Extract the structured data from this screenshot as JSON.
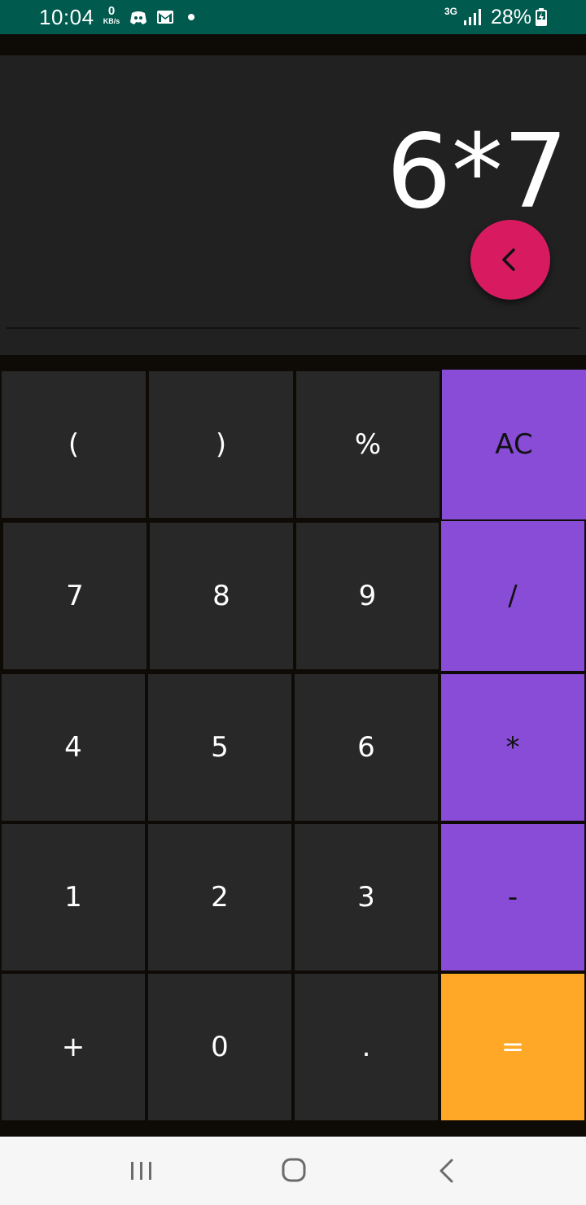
{
  "status_bar": {
    "time": "10:04",
    "net_speed_value": "0",
    "net_speed_unit": "KB/s",
    "network_type": "3G",
    "battery": "28%",
    "background_color": "#005a4e"
  },
  "display": {
    "expression": "6*7",
    "backspace_icon": "chevron-left-icon",
    "backspace_color": "#d81b60"
  },
  "keypad": {
    "rows": [
      [
        "(",
        ")",
        "%",
        "AC"
      ],
      [
        "7",
        "8",
        "9",
        "/"
      ],
      [
        "4",
        "5",
        "6",
        "*"
      ],
      [
        "1",
        "2",
        "3",
        "-"
      ],
      [
        "+",
        "0",
        ".",
        "="
      ]
    ],
    "colors": {
      "digit_key": "#282828",
      "operator_key": "#884cd6",
      "equals_key": "#ffa726"
    }
  },
  "nav_bar": {
    "icons": [
      "recents-icon",
      "home-icon",
      "back-icon"
    ]
  }
}
